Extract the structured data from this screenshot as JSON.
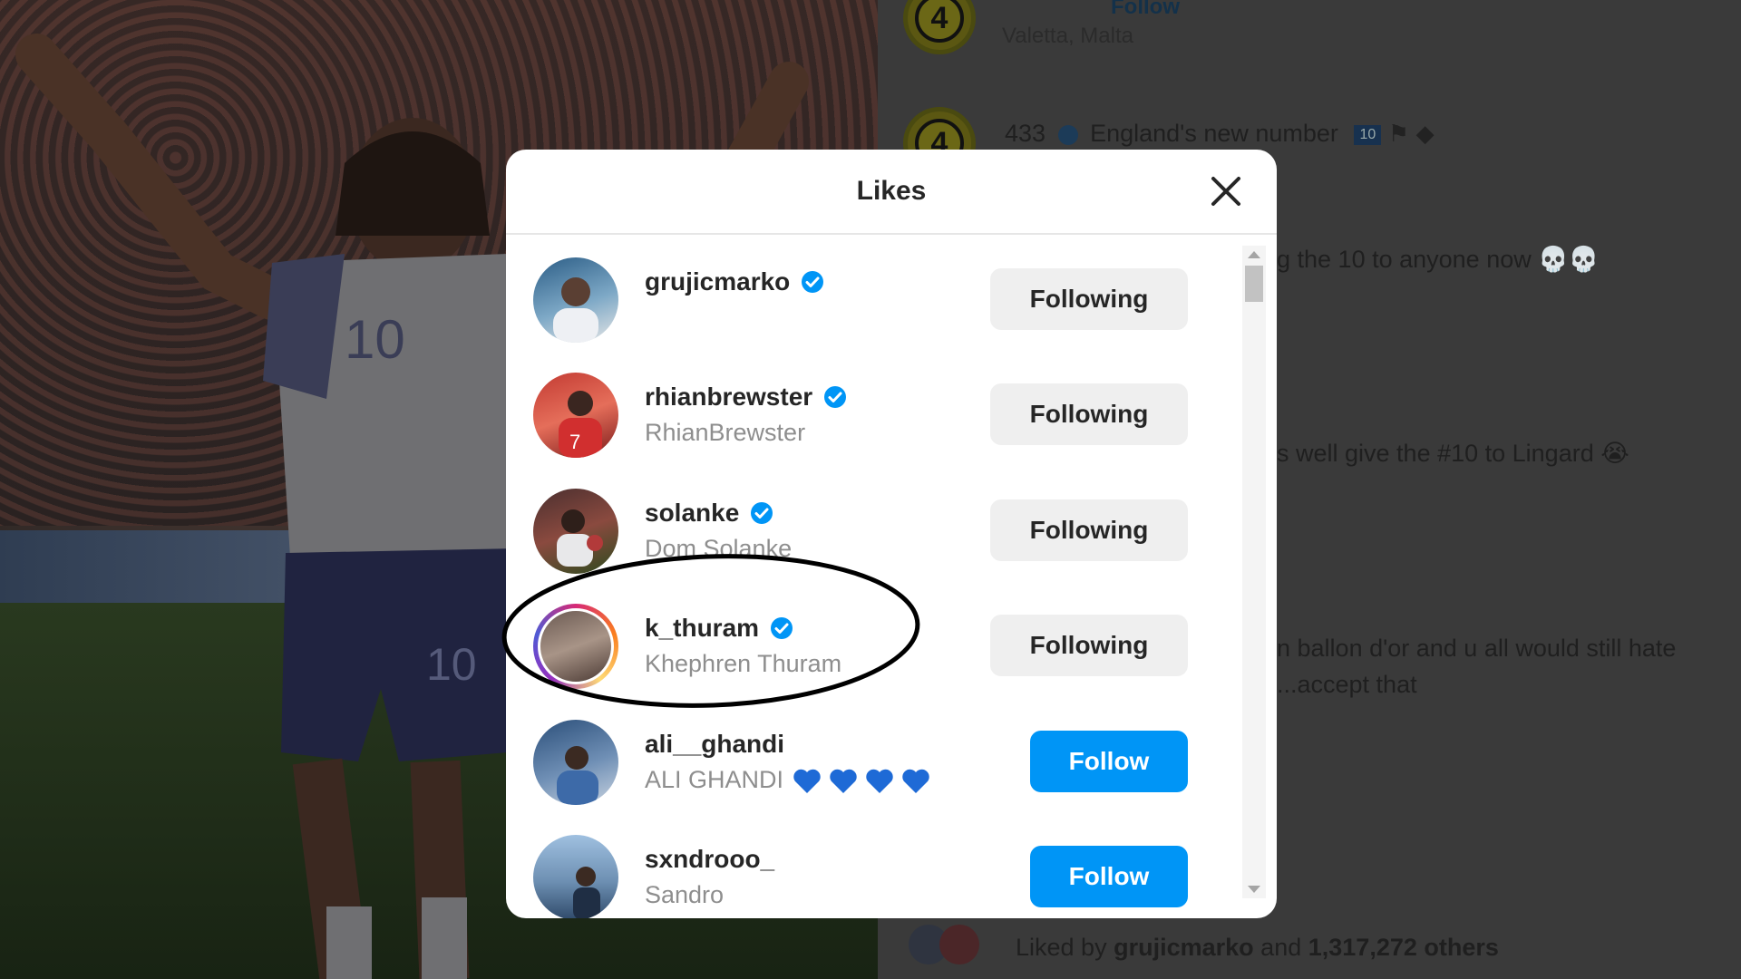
{
  "modal": {
    "title": "Likes",
    "users": [
      {
        "username": "grujicmarko",
        "fullname": "",
        "verified": true,
        "button": "Following"
      },
      {
        "username": "rhianbrewster",
        "fullname": "RhianBrewster",
        "verified": true,
        "button": "Following"
      },
      {
        "username": "solanke",
        "fullname": "Dom Solanke",
        "verified": true,
        "button": "Following"
      },
      {
        "username": "k_thuram",
        "fullname": "Khephren Thuram",
        "verified": true,
        "button": "Following"
      },
      {
        "username": "ali__ghandi",
        "fullname": "ALI GHANDI",
        "verified": false,
        "button": "Follow"
      },
      {
        "username": "sxndrooo_",
        "fullname": "Sandro",
        "verified": false,
        "button": "Follow"
      }
    ]
  },
  "feed": {
    "location": "Valetta, Malta",
    "caption_user": "433",
    "caption_text": "England's new number",
    "caption_badge": "10",
    "follow_label": "Follow",
    "comment_1": "g the 10 to anyone now 💀💀",
    "comment_2": "s well give the #10 to Lingard 😭",
    "comment_3a": "n ballon d'or and u all would still hate",
    "comment_3b": "...accept that",
    "liked_by_prefix": "Liked by",
    "liked_by_user": "grujicmarko",
    "liked_by_and": "and",
    "liked_by_others": "1,317,272 others",
    "avatar_label": "4"
  },
  "colors": {
    "follow_blue": "#0095f6",
    "following_gray": "#efefef",
    "verified_blue": "#0095f6"
  }
}
